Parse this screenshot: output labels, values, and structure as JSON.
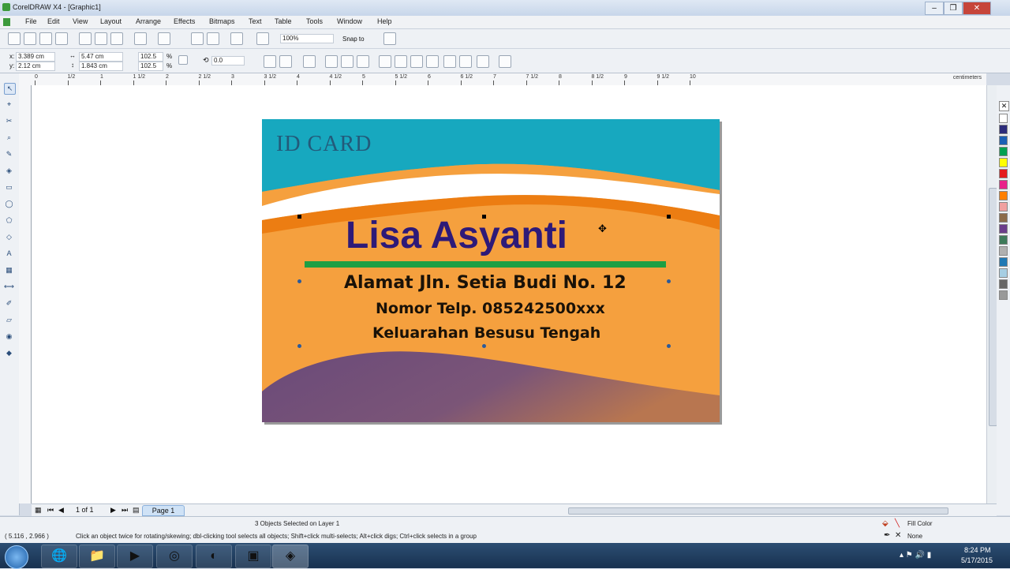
{
  "window": {
    "title": "CorelDRAW X4 - [Graphic1]"
  },
  "menu": [
    "File",
    "Edit",
    "View",
    "Layout",
    "Arrange",
    "Effects",
    "Bitmaps",
    "Text",
    "Table",
    "Tools",
    "Window",
    "Help"
  ],
  "toolbar": {
    "zoom": "100%",
    "snap_to": "Snap to"
  },
  "property_bar": {
    "x": "3.389 cm",
    "y": "2.12 cm",
    "width": "5.47 cm",
    "height": "1.843 cm",
    "scale_x": "102.5",
    "scale_y": "102.5",
    "percent": "%",
    "rotation": "0.0"
  },
  "ruler": {
    "labels": [
      "0",
      "1/2",
      "1",
      "1 1/2",
      "2",
      "2 1/2",
      "3",
      "3 1/2",
      "4",
      "4 1/2",
      "5",
      "5 1/2",
      "6",
      "6 1/2",
      "7",
      "7 1/2",
      "8",
      "8 1/2",
      "9",
      "9 1/2",
      "10"
    ],
    "unit": "centimeters"
  },
  "card": {
    "heading": "ID CARD",
    "name": "Lisa Asyanti",
    "line1": "Alamat Jln. Setia Budi No. 12",
    "line2": "Nomor Telp. 085242500xxx",
    "line3": "Keluarahan Besusu Tengah",
    "colors": {
      "teal": "#17a8bf",
      "orange": "#f5a03e",
      "dark_orange": "#ec7d12",
      "name": "#2e1a78",
      "green": "#1e9f43",
      "purple": "#6a4a7a"
    }
  },
  "palette": [
    "#ffffff",
    "#2b2b7a",
    "#1a5fb4",
    "#00a050",
    "#ffff00",
    "#e41a1c",
    "#e8208a",
    "#ff7f00",
    "#f0a0a0",
    "#8b6b4a",
    "#6a3d8a",
    "#3d7a5a",
    "#b0b0b0",
    "#1f78b4",
    "#a6cee3",
    "#666666",
    "#999999"
  ],
  "page_nav": {
    "counter": "1 of 1",
    "tab": "Page 1"
  },
  "status": {
    "selection": "3 Objects Selected on Layer 1",
    "coords": "( 5.116 , 2.966 )",
    "hint": "Click an object twice for rotating/skewing; dbl-clicking tool selects all objects; Shift+click multi-selects; Alt+click digs; Ctrl+click selects in a group",
    "fill_label": "Fill Color",
    "outline_label": "None"
  },
  "taskbar": {
    "time": "8:24 PM",
    "date": "5/17/2015",
    "apps": [
      "explorer-icon",
      "ie-icon",
      "folder-icon",
      "media-player-icon",
      "chrome-icon",
      "browser-icon",
      "video-icon",
      "corel-icon"
    ]
  }
}
